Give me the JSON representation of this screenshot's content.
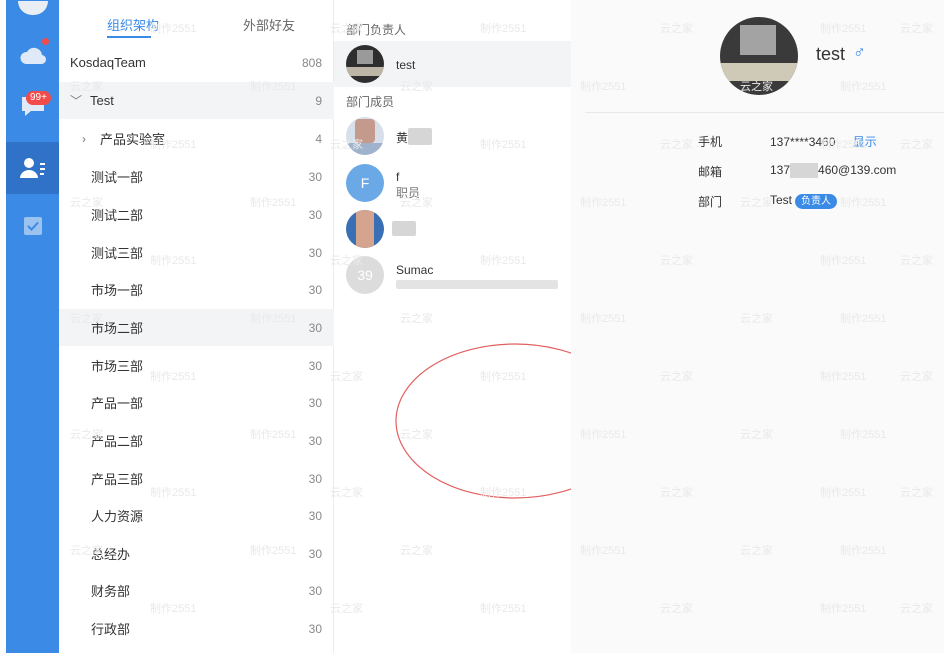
{
  "rail": {
    "unread_badge": "99+"
  },
  "tree": {
    "tabs": [
      {
        "label": "组织架构"
      },
      {
        "label": "外部好友"
      }
    ],
    "rows": [
      {
        "label": "KosdaqTeam",
        "count": "808"
      },
      {
        "label": "Test",
        "count": "9"
      },
      {
        "label": "产品实验室",
        "count": "4"
      },
      {
        "label": "测试一部",
        "count": "30"
      },
      {
        "label": "测试二部",
        "count": "30"
      },
      {
        "label": "测试三部",
        "count": "30"
      },
      {
        "label": "市场一部",
        "count": "30"
      },
      {
        "label": "市场二部",
        "count": "30"
      },
      {
        "label": "市场三部",
        "count": "30"
      },
      {
        "label": "产品一部",
        "count": "30"
      },
      {
        "label": "产品二部",
        "count": "30"
      },
      {
        "label": "产品三部",
        "count": "30"
      },
      {
        "label": "人力资源",
        "count": "30"
      },
      {
        "label": "总经办",
        "count": "30"
      },
      {
        "label": "财务部",
        "count": "30"
      },
      {
        "label": "行政部",
        "count": "30"
      }
    ]
  },
  "members": {
    "head_title": "部门负责人",
    "head_name": "test",
    "member_title": "部门成员",
    "items": [
      {
        "name": "黄",
        "sub": ""
      },
      {
        "name": "f",
        "sub": "职员",
        "initial": "F"
      },
      {
        "name": "",
        "sub": ""
      },
      {
        "name": "Sumac",
        "sub": "",
        "initial": "39"
      }
    ]
  },
  "detail": {
    "name": "test",
    "gender_icon": "♂",
    "phone_label": "手机",
    "phone_value": "137****3460",
    "phone_reveal": "显示",
    "email_label": "邮箱",
    "email_value_start": "137",
    "email_value_end": "460@139.com",
    "dept_label": "部门",
    "dept_value": "Test",
    "dept_tag": "负责人"
  },
  "watermarks": [
    "制作2551",
    "云之家"
  ],
  "colors": {
    "accent": "#3b8ae6",
    "badge": "#f34a4a",
    "annotation": "#e06060"
  }
}
